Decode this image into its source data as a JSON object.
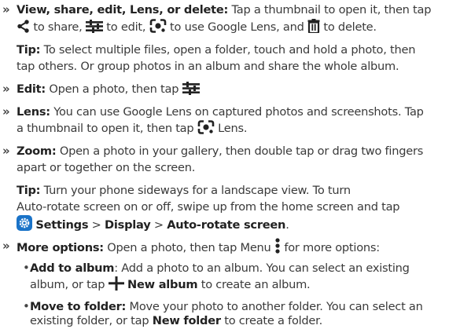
{
  "view": {
    "bullet": "»",
    "heading": "View, share, edit, Lens, or delete:",
    "text1": " Tap a thumbnail to open it, then tap",
    "t_share": " to share, ",
    "t_edit": " to edit, ",
    "t_lens": " to use Google Lens, and ",
    "t_delete": " to delete."
  },
  "tip1": {
    "label": "Tip:",
    "line1": " To select multiple files, open a folder, touch and hold a photo, then",
    "line2": "tap others. Or group photos in an album and share the whole album."
  },
  "edit": {
    "bullet": "»",
    "heading": "Edit:",
    "text": " Open a photo, then tap "
  },
  "lens": {
    "bullet": "»",
    "heading": "Lens:",
    "line1": " You can use Google Lens on captured photos and screenshots. Tap",
    "line2": "a thumbnail to open it, then tap ",
    "line2_end": " Lens."
  },
  "zoom": {
    "bullet": "»",
    "heading": "Zoom:",
    "line1": " Open a photo in your gallery, then double tap or drag two fingers",
    "line2": "apart or together on the screen."
  },
  "tip2": {
    "label": "Tip:",
    "line1": " Turn your phone sideways for a landscape view. To turn",
    "line2": "Auto-rotate screen on or off, swipe up from the home screen and tap",
    "settings": "Settings",
    "sep1": " > ",
    "display": "Display",
    "sep2": " > ",
    "autorotate": "Auto-rotate screen",
    "end": "."
  },
  "more": {
    "bullet": "»",
    "heading": "More options:",
    "text": " Open a photo, then tap Menu ",
    "text_end": " for more options:"
  },
  "album": {
    "bullet": "•",
    "heading": "Add to album",
    "line1": ": Add a photo to an album. You can select an existing",
    "line2": "album, or tap ",
    "new_album": "New album",
    "line2_end": " to create an album."
  },
  "folder": {
    "bullet": "•",
    "heading": "Move to folder:",
    "line1": " Move your photo to another folder. You can select an",
    "line2": "existing folder, or tap ",
    "new_folder": "New folder",
    "line2_end": " to create a folder."
  },
  "icons": {
    "share": "share-icon",
    "edit": "edit-sliders-icon",
    "lens": "google-lens-icon",
    "delete": "trash-icon",
    "settings": "settings-gear-icon",
    "menu": "vertical-dots-menu-icon",
    "add": "plus-icon"
  },
  "colors": {
    "settings_icon_bg": "#1a73c8"
  }
}
